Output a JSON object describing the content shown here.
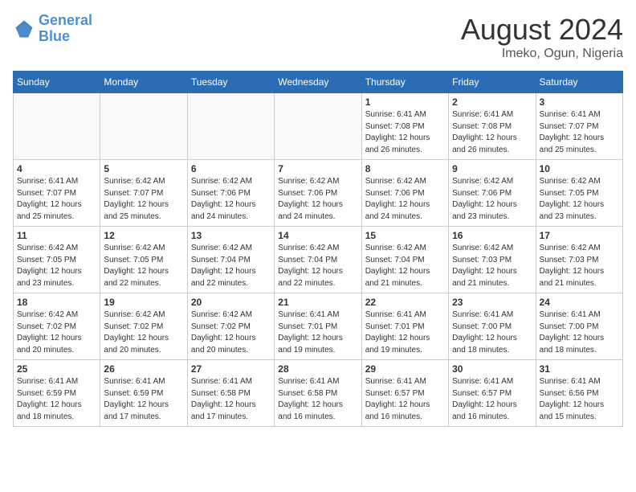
{
  "header": {
    "logo_line1": "General",
    "logo_line2": "Blue",
    "month_title": "August 2024",
    "location": "Imeko, Ogun, Nigeria"
  },
  "days_of_week": [
    "Sunday",
    "Monday",
    "Tuesday",
    "Wednesday",
    "Thursday",
    "Friday",
    "Saturday"
  ],
  "weeks": [
    [
      {
        "day": "",
        "info": ""
      },
      {
        "day": "",
        "info": ""
      },
      {
        "day": "",
        "info": ""
      },
      {
        "day": "",
        "info": ""
      },
      {
        "day": "1",
        "info": "Sunrise: 6:41 AM\nSunset: 7:08 PM\nDaylight: 12 hours\nand 26 minutes."
      },
      {
        "day": "2",
        "info": "Sunrise: 6:41 AM\nSunset: 7:08 PM\nDaylight: 12 hours\nand 26 minutes."
      },
      {
        "day": "3",
        "info": "Sunrise: 6:41 AM\nSunset: 7:07 PM\nDaylight: 12 hours\nand 25 minutes."
      }
    ],
    [
      {
        "day": "4",
        "info": "Sunrise: 6:41 AM\nSunset: 7:07 PM\nDaylight: 12 hours\nand 25 minutes."
      },
      {
        "day": "5",
        "info": "Sunrise: 6:42 AM\nSunset: 7:07 PM\nDaylight: 12 hours\nand 25 minutes."
      },
      {
        "day": "6",
        "info": "Sunrise: 6:42 AM\nSunset: 7:06 PM\nDaylight: 12 hours\nand 24 minutes."
      },
      {
        "day": "7",
        "info": "Sunrise: 6:42 AM\nSunset: 7:06 PM\nDaylight: 12 hours\nand 24 minutes."
      },
      {
        "day": "8",
        "info": "Sunrise: 6:42 AM\nSunset: 7:06 PM\nDaylight: 12 hours\nand 24 minutes."
      },
      {
        "day": "9",
        "info": "Sunrise: 6:42 AM\nSunset: 7:06 PM\nDaylight: 12 hours\nand 23 minutes."
      },
      {
        "day": "10",
        "info": "Sunrise: 6:42 AM\nSunset: 7:05 PM\nDaylight: 12 hours\nand 23 minutes."
      }
    ],
    [
      {
        "day": "11",
        "info": "Sunrise: 6:42 AM\nSunset: 7:05 PM\nDaylight: 12 hours\nand 23 minutes."
      },
      {
        "day": "12",
        "info": "Sunrise: 6:42 AM\nSunset: 7:05 PM\nDaylight: 12 hours\nand 22 minutes."
      },
      {
        "day": "13",
        "info": "Sunrise: 6:42 AM\nSunset: 7:04 PM\nDaylight: 12 hours\nand 22 minutes."
      },
      {
        "day": "14",
        "info": "Sunrise: 6:42 AM\nSunset: 7:04 PM\nDaylight: 12 hours\nand 22 minutes."
      },
      {
        "day": "15",
        "info": "Sunrise: 6:42 AM\nSunset: 7:04 PM\nDaylight: 12 hours\nand 21 minutes."
      },
      {
        "day": "16",
        "info": "Sunrise: 6:42 AM\nSunset: 7:03 PM\nDaylight: 12 hours\nand 21 minutes."
      },
      {
        "day": "17",
        "info": "Sunrise: 6:42 AM\nSunset: 7:03 PM\nDaylight: 12 hours\nand 21 minutes."
      }
    ],
    [
      {
        "day": "18",
        "info": "Sunrise: 6:42 AM\nSunset: 7:02 PM\nDaylight: 12 hours\nand 20 minutes."
      },
      {
        "day": "19",
        "info": "Sunrise: 6:42 AM\nSunset: 7:02 PM\nDaylight: 12 hours\nand 20 minutes."
      },
      {
        "day": "20",
        "info": "Sunrise: 6:42 AM\nSunset: 7:02 PM\nDaylight: 12 hours\nand 20 minutes."
      },
      {
        "day": "21",
        "info": "Sunrise: 6:41 AM\nSunset: 7:01 PM\nDaylight: 12 hours\nand 19 minutes."
      },
      {
        "day": "22",
        "info": "Sunrise: 6:41 AM\nSunset: 7:01 PM\nDaylight: 12 hours\nand 19 minutes."
      },
      {
        "day": "23",
        "info": "Sunrise: 6:41 AM\nSunset: 7:00 PM\nDaylight: 12 hours\nand 18 minutes."
      },
      {
        "day": "24",
        "info": "Sunrise: 6:41 AM\nSunset: 7:00 PM\nDaylight: 12 hours\nand 18 minutes."
      }
    ],
    [
      {
        "day": "25",
        "info": "Sunrise: 6:41 AM\nSunset: 6:59 PM\nDaylight: 12 hours\nand 18 minutes."
      },
      {
        "day": "26",
        "info": "Sunrise: 6:41 AM\nSunset: 6:59 PM\nDaylight: 12 hours\nand 17 minutes."
      },
      {
        "day": "27",
        "info": "Sunrise: 6:41 AM\nSunset: 6:58 PM\nDaylight: 12 hours\nand 17 minutes."
      },
      {
        "day": "28",
        "info": "Sunrise: 6:41 AM\nSunset: 6:58 PM\nDaylight: 12 hours\nand 16 minutes."
      },
      {
        "day": "29",
        "info": "Sunrise: 6:41 AM\nSunset: 6:57 PM\nDaylight: 12 hours\nand 16 minutes."
      },
      {
        "day": "30",
        "info": "Sunrise: 6:41 AM\nSunset: 6:57 PM\nDaylight: 12 hours\nand 16 minutes."
      },
      {
        "day": "31",
        "info": "Sunrise: 6:41 AM\nSunset: 6:56 PM\nDaylight: 12 hours\nand 15 minutes."
      }
    ]
  ]
}
